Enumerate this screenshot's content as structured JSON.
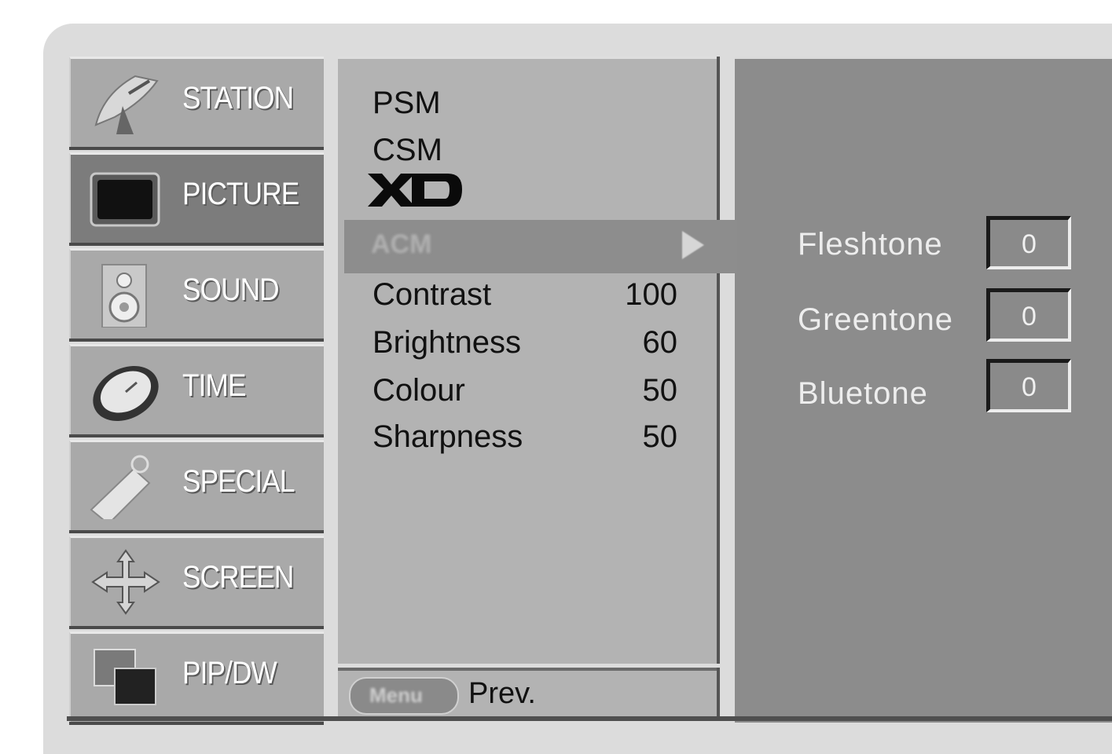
{
  "categories": [
    {
      "label": "STATION",
      "icon": "satellite-dish-icon",
      "active": false
    },
    {
      "label": "PICTURE",
      "icon": "tv-icon",
      "active": true
    },
    {
      "label": "SOUND",
      "icon": "speaker-icon",
      "active": false
    },
    {
      "label": "TIME",
      "icon": "clock-icon",
      "active": false
    },
    {
      "label": "SPECIAL",
      "icon": "tag-icon",
      "active": false
    },
    {
      "label": "SCREEN",
      "icon": "move-arrows-icon",
      "active": false
    },
    {
      "label": "PIP/DW",
      "icon": "pip-windows-icon",
      "active": false
    }
  ],
  "picture_menu": {
    "psm": "PSM",
    "csm": "CSM",
    "xd_logo": "XD",
    "acm": "ACM",
    "items": [
      {
        "label": "Contrast",
        "value": "100"
      },
      {
        "label": "Brightness",
        "value": "60"
      },
      {
        "label": "Colour",
        "value": "50"
      },
      {
        "label": "Sharpness",
        "value": "50"
      }
    ]
  },
  "acm_submenu": [
    {
      "label": "Fleshtone",
      "value": "0"
    },
    {
      "label": "Greentone",
      "value": "0"
    },
    {
      "label": "Bluetone",
      "value": "0"
    }
  ],
  "footer": {
    "menu_button": "Menu",
    "prev": "Prev."
  },
  "colors": {
    "highlight": "#8d8d8d",
    "panel": "#b3b3b3",
    "submenu_bg": "#8c8c8c"
  }
}
